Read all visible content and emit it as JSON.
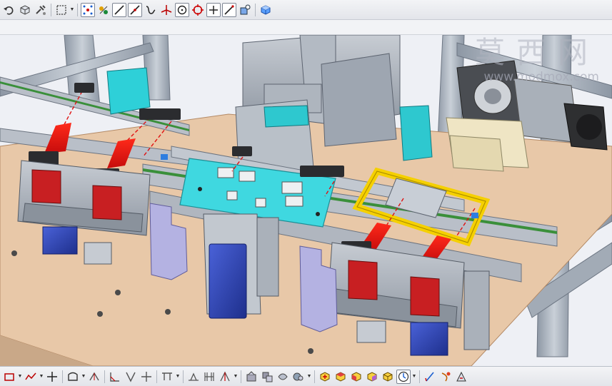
{
  "watermark": {
    "chinese_text": "莫西网",
    "url": "www.modmox.com"
  },
  "top_toolbar": {
    "icons": [
      "undo-icon",
      "solid-icon",
      "tools-icon",
      "selection-box-icon",
      "dropdown-arrow-icon",
      "snap-points-icon",
      "sketch-constraints-icon",
      "line-icon",
      "diagonal-line-icon",
      "spline-icon",
      "axis-system-icon",
      "circle-point-icon",
      "target-circle-icon",
      "cross-point-icon",
      "slash-line-icon",
      "render-style-icon",
      "cube-icon"
    ]
  },
  "bottom_toolbar": {
    "icons": [
      "rectangle-icon",
      "curve-icon",
      "point-icon",
      "profile-icon",
      "projection-icon",
      "chamfer-icon",
      "corner-icon",
      "trim-icon",
      "break-icon",
      "constraint-icon",
      "dimension-icon",
      "mirror-icon",
      "symmetry-icon",
      "rotate-icon",
      "scale-icon",
      "hide-icon",
      "fit-all-icon",
      "view-top-icon",
      "view-front-icon",
      "view-right-icon",
      "view-iso-icon",
      "clock-view-icon",
      "measure-icon",
      "inertia-icon",
      "analysis-icon"
    ]
  },
  "colors": {
    "toolbar_bg": "#e8eaee",
    "viewport_bg": "#eef0f5",
    "table_plate": "#e8c8a8",
    "aluminum_frame": "#aab3bf",
    "conveyor_plate": "#3fd8e0",
    "guide_rail": "#b9bfc8",
    "belt_green": "#3a8f3a",
    "fixture_red": "#c81f22",
    "selected_frame": "#f5d000",
    "motor_blue": "#2f48b8",
    "bracket_lavender": "#b4b2e2",
    "laser_beam": "#e01010"
  }
}
